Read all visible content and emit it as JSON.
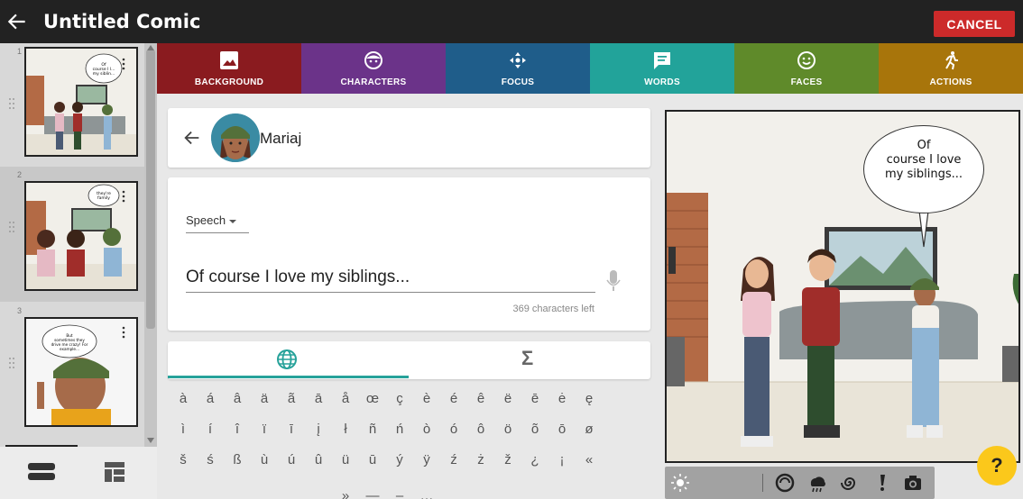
{
  "header": {
    "title": "Untitled Comic",
    "cancel_label": "CANCEL"
  },
  "panels": [
    {
      "number": "1",
      "bubble_text": "Of course I love my siblings..."
    },
    {
      "number": "2",
      "bubble_text": "they're family"
    },
    {
      "number": "3",
      "bubble_text": "But sometimes they drive me crazy! For example..."
    }
  ],
  "tabs": [
    {
      "label": "BACKGROUND",
      "icon": "image-icon",
      "color": "#8a1b1f"
    },
    {
      "label": "CHARACTERS",
      "icon": "face-icon",
      "color": "#6b3389"
    },
    {
      "label": "FOCUS",
      "icon": "move-icon",
      "color": "#1f5d8a"
    },
    {
      "label": "WORDS",
      "icon": "speech-icon",
      "color": "#22a39a",
      "active": true
    },
    {
      "label": "FACES",
      "icon": "smile-icon",
      "color": "#5f8a2a"
    },
    {
      "label": "ACTIONS",
      "icon": "run-icon",
      "color": "#a8750b"
    }
  ],
  "character": {
    "name": "Mariaj"
  },
  "speech": {
    "type": "Speech",
    "text": "Of course I love my siblings...",
    "chars_left": "369 characters left"
  },
  "keyboard": {
    "rows": [
      [
        "à",
        "á",
        "â",
        "ä",
        "ã",
        "ā",
        "å",
        "œ",
        "ç",
        "è",
        "é",
        "ê",
        "ë",
        "ē",
        "ė",
        "ę"
      ],
      [
        "ì",
        "í",
        "î",
        "ï",
        "ī",
        "į",
        "ł",
        "ñ",
        "ń",
        "ò",
        "ó",
        "ô",
        "ö",
        "õ",
        "ō",
        "ø"
      ],
      [
        "š",
        "ś",
        "ß",
        "ù",
        "ú",
        "û",
        "ü",
        "ū",
        "ý",
        "ÿ",
        "ź",
        "ż",
        "ž",
        "¿",
        "¡",
        "«"
      ],
      [
        "»",
        "—",
        "–",
        "…"
      ]
    ]
  },
  "comic": {
    "bubble_line1": "Of",
    "bubble_line2": "course I love",
    "bubble_line3": "my siblings..."
  },
  "help_label": "?"
}
